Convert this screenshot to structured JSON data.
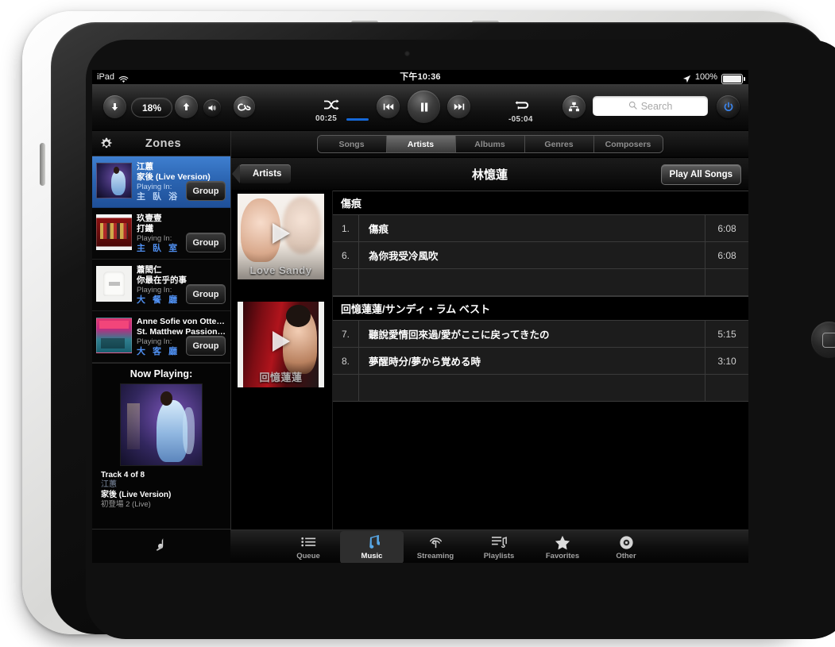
{
  "device": {
    "name": "ipad",
    "orientation": "landscape"
  },
  "status_bar": {
    "carrier": "iPad",
    "wifi_icon": "wifi-icon",
    "time": "下午10:36",
    "location_icon": "location-arrow-icon",
    "battery_percent": "100%",
    "battery_icon": "battery-full-icon"
  },
  "toolbar": {
    "volume_down_icon": "arrow-down-icon",
    "volume_value": "18%",
    "volume_up_icon": "arrow-up-icon",
    "mute_icon": "speaker-icon",
    "lastfm_icon": "lastfm-logo-icon",
    "shuffle_icon": "shuffle-icon",
    "elapsed_time": "00:25",
    "remaining_time": "-05:04",
    "repeat_icon": "repeat-icon",
    "previous_icon": "previous-track-icon",
    "pause_icon": "pause-icon",
    "next_icon": "next-track-icon",
    "network_icon": "network-hierarchy-icon",
    "search_placeholder": "Search",
    "search_value": "",
    "search_icon": "search-icon",
    "power_icon": "power-icon",
    "accent_color": "#1568d8",
    "power_color": "#2f7ff0"
  },
  "sidebar": {
    "gear_icon": "gear-icon",
    "title": "Zones",
    "playing_in_label": "Playing In:",
    "group_label": "Group",
    "zones": [
      {
        "artist": "江蕙",
        "track": "家後 (Live Version)",
        "playing_in": "Playing In:",
        "room": "主 臥 浴",
        "group_label": "Group",
        "selected": true
      },
      {
        "artist": "玖壹壹",
        "track": "打鐵",
        "playing_in": "Playing In:",
        "room": "主 臥 室",
        "group_label": "Group",
        "selected": false
      },
      {
        "artist": "蕭閎仁",
        "track": "你最在乎的事",
        "playing_in": "Playing In:",
        "room": "大 餐 廳",
        "group_label": "Group",
        "selected": false
      },
      {
        "artist": "Anne Sofie von Otter e…",
        "track": "St. Matthew Passion,…",
        "playing_in": "Playing In:",
        "room": "大 客 廳",
        "group_label": "Group",
        "selected": false
      }
    ],
    "now_playing": {
      "heading": "Now Playing:",
      "track_of": "Track 4 of 8",
      "artist": "江蕙",
      "song": "家後 (Live Version)",
      "album": "初登場 2 (Live)"
    },
    "footer_icon": "music-note-icon"
  },
  "main": {
    "segments": [
      {
        "label": "Songs",
        "active": false
      },
      {
        "label": "Artists",
        "active": true
      },
      {
        "label": "Albums",
        "active": false
      },
      {
        "label": "Genres",
        "active": false
      },
      {
        "label": "Composers",
        "active": false
      }
    ],
    "back_label": "Artists",
    "title": "林憶蓮",
    "play_all_label": "Play All Songs",
    "albums": [
      {
        "cover_caption": "Love Sandy",
        "play_icon": "play-icon",
        "name": "傷痕",
        "tracks": [
          {
            "number": "1.",
            "title": "傷痕",
            "duration": "6:08"
          },
          {
            "number": "6.",
            "title": "為你我受冷風吹",
            "duration": "6:08"
          },
          {
            "number": "",
            "title": "",
            "duration": ""
          }
        ]
      },
      {
        "cover_caption": "回憶蓮蓮",
        "play_icon": "play-icon",
        "name": "回憶蓮蓮/サンディ・ラム ベスト",
        "tracks": [
          {
            "number": "7.",
            "title": "聽說愛情回來過/愛がここに戻ってきたの",
            "duration": "5:15"
          },
          {
            "number": "8.",
            "title": "夢醒時分/夢から覚める時",
            "duration": "3:10"
          },
          {
            "number": "",
            "title": "",
            "duration": ""
          }
        ]
      }
    ]
  },
  "tabbar": {
    "tabs": [
      {
        "label": "Queue",
        "icon": "list-icon",
        "active": false
      },
      {
        "label": "Music",
        "icon": "music-note-icon",
        "active": true
      },
      {
        "label": "Streaming",
        "icon": "broadcast-icon",
        "active": false
      },
      {
        "label": "Playlists",
        "icon": "playlist-icon",
        "active": false
      },
      {
        "label": "Favorites",
        "icon": "star-icon",
        "active": false
      },
      {
        "label": "Other",
        "icon": "disc-icon",
        "active": false
      }
    ]
  }
}
